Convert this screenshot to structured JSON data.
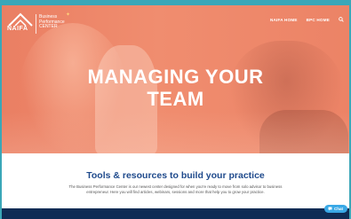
{
  "brand": {
    "logo_word": "NAIFA",
    "line1": "Business",
    "line2": "Performance",
    "line3": "CENTER"
  },
  "nav": {
    "items": [
      {
        "label": "NAIFA HOME"
      },
      {
        "label": "BPC HOME"
      }
    ],
    "search_icon": "search-icon"
  },
  "hero": {
    "title_line1": "MANAGING YOUR",
    "title_line2": "TEAM"
  },
  "section": {
    "heading": "Tools & resources to build your practice",
    "description": "The Business Performance Center is our newest center designed for when you're ready to move from solo advisor to business entrepreneur. Here you will find articles, webinars, sessions and more that help you to grow your practice."
  },
  "chat": {
    "label": "Chat",
    "icon": "chat-bubble-icon"
  },
  "colors": {
    "hero_overlay": "#ec8366",
    "heading": "#1f4a8c",
    "footer": "#0f2c55",
    "chat": "#39a8e6",
    "frame": "#3aa7b8"
  }
}
